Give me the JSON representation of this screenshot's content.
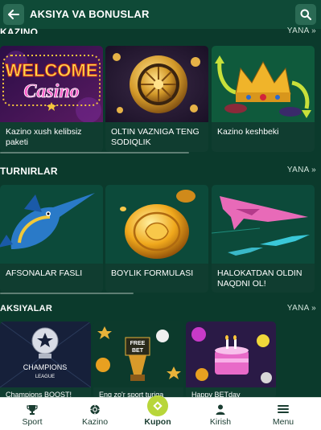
{
  "header": {
    "title": "AKSIYA VA BONUSLAR"
  },
  "kazino": {
    "title": "KAZINO",
    "more": "YANA »",
    "cards": [
      {
        "caption": "Kazino xush kelibsiz paketi",
        "logo_line1": "WELCOME",
        "logo_line2": "Casino"
      },
      {
        "caption": "OLTIN VAZNIGA TENG SODIQLIK"
      },
      {
        "caption": "Kazino keshbeki"
      }
    ]
  },
  "turnirlar": {
    "title": "TURNIRLAR",
    "more": "YANA »",
    "cards": [
      {
        "caption": "AFSONALAR FASLI"
      },
      {
        "caption": "BOYLIK FORMULASI"
      },
      {
        "caption": "HALOKATDAN OLDIN NAQDNI OL!"
      }
    ]
  },
  "aksiyalar": {
    "title": "AKSIYALAR",
    "more": "YANA »",
    "cards": [
      {
        "caption": "Champions BOOST!",
        "logo_line1": "CHAMPIONS",
        "logo_line2": "LEAGUE"
      },
      {
        "caption": "Eng zo'r sport turiga",
        "badge_line1": "FREE",
        "badge_line2": "BET"
      },
      {
        "caption": "Happy BETday"
      }
    ]
  },
  "nav": {
    "items": [
      {
        "label": "Sport",
        "icon": "trophy-icon"
      },
      {
        "label": "Kazino",
        "icon": "casino-chip-icon"
      },
      {
        "label": "Kupon",
        "icon": "coupon-icon"
      },
      {
        "label": "Kirish",
        "icon": "user-icon"
      },
      {
        "label": "Menu",
        "icon": "menu-icon"
      }
    ]
  },
  "colors": {
    "background": "#0b3a2c",
    "header": "#0f4a37",
    "accent": "#b8d63a"
  }
}
